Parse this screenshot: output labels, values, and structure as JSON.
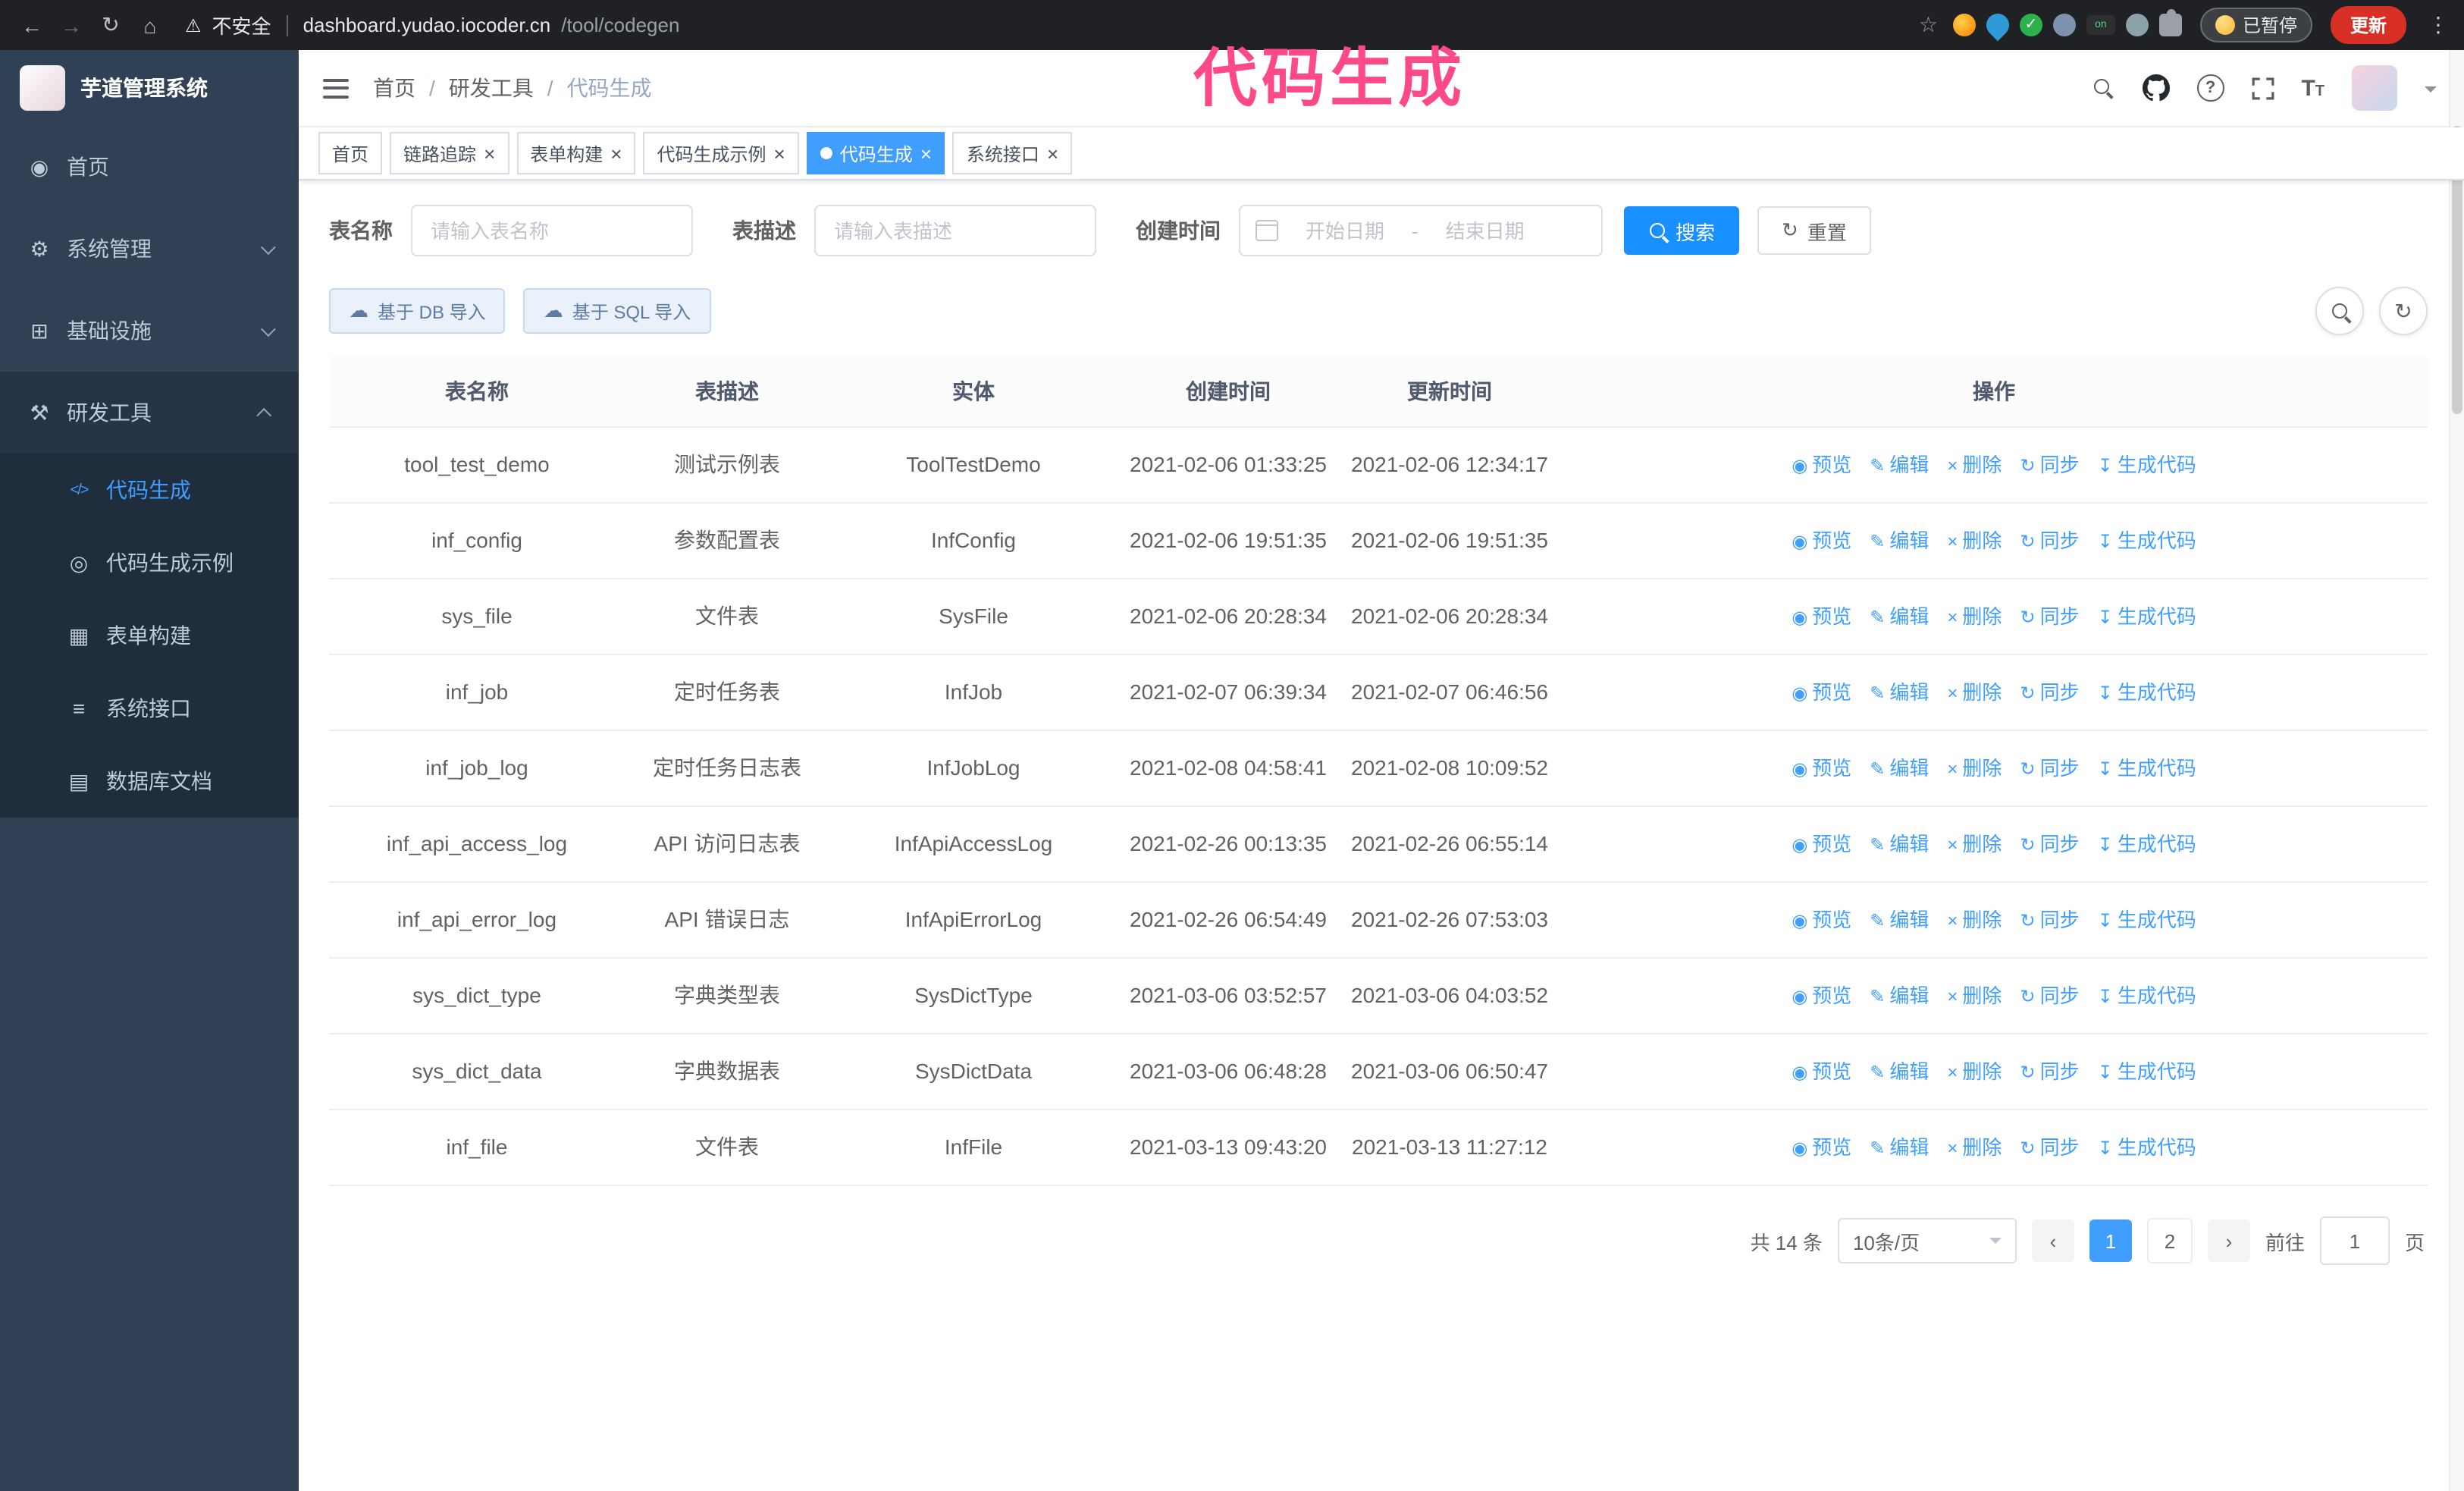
{
  "browser": {
    "security_label": "不安全",
    "url_host": "dashboard.yudao.iocoder.cn",
    "url_path": "/tool/codegen",
    "paused_badge": "已暂停",
    "update_button": "更新"
  },
  "overlay_title": "代码生成",
  "sidebar": {
    "logo_title": "芋道管理系统",
    "items": [
      {
        "label": "首页"
      },
      {
        "label": "系统管理"
      },
      {
        "label": "基础设施"
      },
      {
        "label": "研发工具"
      }
    ],
    "subitems": [
      {
        "label": "代码生成"
      },
      {
        "label": "代码生成示例"
      },
      {
        "label": "表单构建"
      },
      {
        "label": "系统接口"
      },
      {
        "label": "数据库文档"
      }
    ]
  },
  "header": {
    "breadcrumb": [
      "首页",
      "研发工具",
      "代码生成"
    ]
  },
  "tabs": [
    {
      "label": "首页"
    },
    {
      "label": "链路追踪"
    },
    {
      "label": "表单构建"
    },
    {
      "label": "代码生成示例"
    },
    {
      "label": "代码生成"
    },
    {
      "label": "系统接口"
    }
  ],
  "filters": {
    "table_name_label": "表名称",
    "table_name_placeholder": "请输入表名称",
    "table_desc_label": "表描述",
    "table_desc_placeholder": "请输入表描述",
    "create_time_label": "创建时间",
    "start_date_placeholder": "开始日期",
    "range_separator": "-",
    "end_date_placeholder": "结束日期",
    "search_button": "搜索",
    "reset_button": "重置"
  },
  "toolbar": {
    "import_db_label": "基于 DB 导入",
    "import_sql_label": "基于 SQL 导入"
  },
  "table": {
    "columns": [
      "表名称",
      "表描述",
      "实体",
      "创建时间",
      "更新时间",
      "操作"
    ],
    "actions": [
      {
        "label": "预览",
        "icon": "preview"
      },
      {
        "label": "编辑",
        "icon": "edit"
      },
      {
        "label": "删除",
        "icon": "delete"
      },
      {
        "label": "同步",
        "icon": "sync"
      },
      {
        "label": "生成代码",
        "icon": "generate"
      }
    ],
    "rows": [
      {
        "name": "tool_test_demo",
        "desc": "测试示例表",
        "entity": "ToolTestDemo",
        "created": "2021-02-06 01:33:25",
        "updated": "2021-02-06 12:34:17"
      },
      {
        "name": "inf_config",
        "desc": "参数配置表",
        "entity": "InfConfig",
        "created": "2021-02-06 19:51:35",
        "updated": "2021-02-06 19:51:35"
      },
      {
        "name": "sys_file",
        "desc": "文件表",
        "entity": "SysFile",
        "created": "2021-02-06 20:28:34",
        "updated": "2021-02-06 20:28:34"
      },
      {
        "name": "inf_job",
        "desc": "定时任务表",
        "entity": "InfJob",
        "created": "2021-02-07 06:39:34",
        "updated": "2021-02-07 06:46:56"
      },
      {
        "name": "inf_job_log",
        "desc": "定时任务日志表",
        "entity": "InfJobLog",
        "created": "2021-02-08 04:58:41",
        "updated": "2021-02-08 10:09:52"
      },
      {
        "name": "inf_api_access_log",
        "desc": "API 访问日志表",
        "entity": "InfApiAccessLog",
        "created": "2021-02-26 00:13:35",
        "updated": "2021-02-26 06:55:14"
      },
      {
        "name": "inf_api_error_log",
        "desc": "API 错误日志",
        "entity": "InfApiErrorLog",
        "created": "2021-02-26 06:54:49",
        "updated": "2021-02-26 07:53:03"
      },
      {
        "name": "sys_dict_type",
        "desc": "字典类型表",
        "entity": "SysDictType",
        "created": "2021-03-06 03:52:57",
        "updated": "2021-03-06 04:03:52"
      },
      {
        "name": "sys_dict_data",
        "desc": "字典数据表",
        "entity": "SysDictData",
        "created": "2021-03-06 06:48:28",
        "updated": "2021-03-06 06:50:47"
      },
      {
        "name": "inf_file",
        "desc": "文件表",
        "entity": "InfFile",
        "created": "2021-03-13 09:43:20",
        "updated": "2021-03-13 11:27:12"
      }
    ]
  },
  "icons": {
    "preview": "◉",
    "edit": "✎",
    "delete": "×",
    "sync": "↻",
    "generate": "↧"
  },
  "pagination": {
    "total_label": "共 14 条",
    "page_size_label": "10条/页",
    "prev": "‹",
    "next": "›",
    "pages": [
      "1",
      "2"
    ],
    "goto_label": "前往",
    "goto_value": "1",
    "page_unit": "页"
  }
}
